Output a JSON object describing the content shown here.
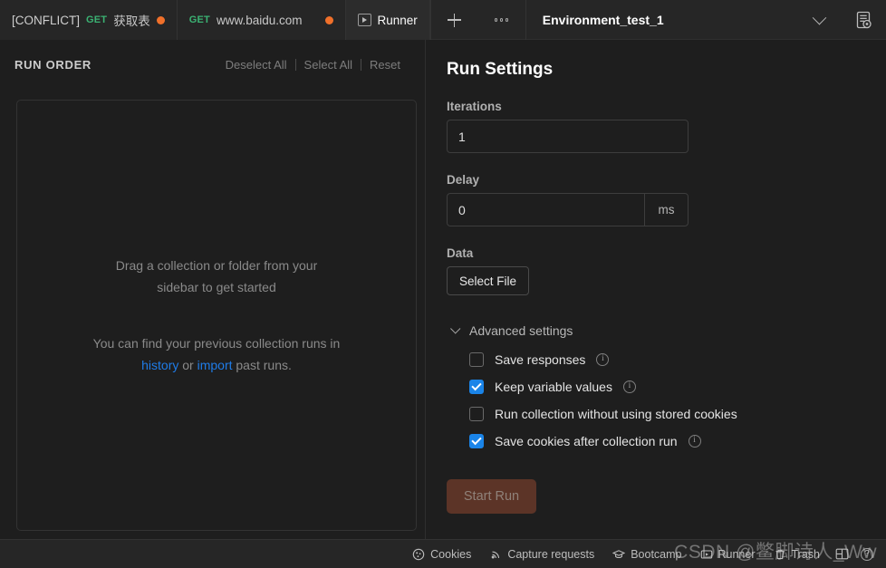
{
  "topbar": {
    "tabs": [
      {
        "conflict": "[CONFLICT]",
        "method": "GET",
        "name": "获取表",
        "icon": "",
        "active": false,
        "unsaved": true
      },
      {
        "conflict": "",
        "method": "GET",
        "name": "www.baidu.com",
        "icon": "",
        "active": false,
        "unsaved": true
      },
      {
        "conflict": "",
        "method": "",
        "name": "Runner",
        "icon": "runner-play-icon",
        "active": true,
        "unsaved": false
      }
    ],
    "new_tab_icon": "plus-icon",
    "more_icon": "ellipsis-icon",
    "environment": "Environment_test_1",
    "env_chevron_icon": "chevron-down-icon",
    "env_quick_look_icon": "environment-quick-look-icon"
  },
  "run_order": {
    "title": "RUN ORDER",
    "deselect_all": "Deselect All",
    "select_all": "Select All",
    "reset": "Reset",
    "dropzone_primary": "Drag a collection or folder from your sidebar to get started",
    "dropzone_secondary_pre": "You can find your previous collection runs in ",
    "link_history": "history",
    "dropzone_secondary_mid": " or ",
    "link_import": "import",
    "dropzone_secondary_post": " past runs."
  },
  "run_settings": {
    "title": "Run Settings",
    "iterations_label": "Iterations",
    "iterations_value": "1",
    "delay_label": "Delay",
    "delay_value": "0",
    "delay_unit": "ms",
    "data_label": "Data",
    "select_file_button": "Select File",
    "advanced_label": "Advanced settings",
    "advanced_chevron_icon": "chevron-down-icon",
    "checkboxes": [
      {
        "label": "Save responses",
        "checked": false,
        "info": true,
        "info_icon": "info-icon"
      },
      {
        "label": "Keep variable values",
        "checked": true,
        "info": true,
        "info_icon": "info-icon"
      },
      {
        "label": "Run collection without using stored cookies",
        "checked": false,
        "info": false,
        "info_icon": ""
      },
      {
        "label": "Save cookies after collection run",
        "checked": true,
        "info": true,
        "info_icon": "info-icon"
      }
    ],
    "start_button": "Start Run"
  },
  "statusbar": {
    "items": [
      {
        "label": "Cookies",
        "icon": "cookie-icon"
      },
      {
        "label": "Capture requests",
        "icon": "satellite-icon"
      },
      {
        "label": "Bootcamp",
        "icon": "graduation-cap-icon"
      },
      {
        "label": "Runner",
        "icon": "runner-play-icon"
      },
      {
        "label": "Trash",
        "icon": "trash-icon"
      }
    ],
    "layout_icon": "two-pane-layout-icon",
    "help_icon": "help-icon"
  },
  "watermark": "CSDN @鳖脚诗人_Ww",
  "colors": {
    "accent_blue": "#1a84e8",
    "link_blue": "#1f7ce8",
    "method_get_green": "#3bb273",
    "unsaved_dot_orange": "#f0702a",
    "start_run_disabled": "#5c3427",
    "app_background": "#1e1e1e",
    "bar_background": "#262626"
  }
}
